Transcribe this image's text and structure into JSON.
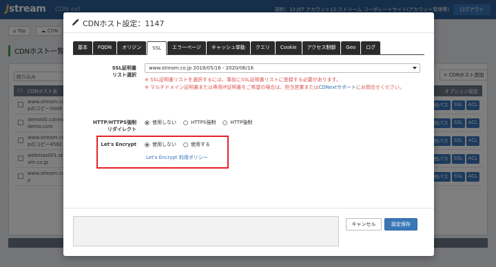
{
  "app": {
    "logo": "stream",
    "logo_j": "J",
    "logo_sub": "CDN ext",
    "account": "契約：12:JST アカウント12:ストリーム コーポレートサイト(アカウント管理等)",
    "logout": "ログアウト"
  },
  "breadcrumb": {
    "home": "Top",
    "cdn": "CDN"
  },
  "bg": {
    "title": "CDNホスト一覧",
    "filter": "絞り込み",
    "add": "CDNホスト追加",
    "col_host": "CDNホスト名",
    "col_option": "オプション設定",
    "rows": [
      {
        "host": "www.stream.co.jp\nのコピー5008"
      },
      {
        "host": "demo00.cdnext\ndemo.com"
      },
      {
        "host": "www.stream.co.jp\nのコピー4582"
      },
      {
        "host": "webmas001.st\nam.co.jp"
      },
      {
        "host": "www.stream.co.jp\np"
      }
    ],
    "row_btns": [
      "他パス",
      "SSL",
      "ACL"
    ]
  },
  "modal": {
    "title": "CDNホスト設定：1147",
    "tabs": [
      "基本",
      "FQDN",
      "オリジン",
      "SSL",
      "エラーページ",
      "キャッシュ挙動",
      "クエリ",
      "Cookie",
      "アクセス制御",
      "Geo",
      "ログ"
    ],
    "active_tab": "SSL",
    "ssl_label_1": "SSL証明書",
    "ssl_label_2": "リスト選択",
    "ssl_value": "www.stream.co.jp 2018/05/16 - 2020/06/16",
    "note_1": "※ SSL証明書リストを選択するには、事前にSSL証明書リストに登録する必要があります。",
    "note_2_pre": "※ マルチドメイン証明書または専用IP証明書をご希望の場合は、担当営業または",
    "note_2_link": "CDNextサポート",
    "note_2_post": "にお問合せください。",
    "redirect_label_1": "HTTP/HTTPS強制",
    "redirect_label_2": "リダイレクト",
    "redirect_options": [
      "使用しない",
      "HTTPS強制",
      "HTTP強制"
    ],
    "le_label": "Let's Encrypt",
    "le_options": [
      "使用しない",
      "使用する"
    ],
    "le_link": "Let's Encrypt 利用ポリシー",
    "cancel": "キャンセル",
    "save": "設定保存"
  }
}
